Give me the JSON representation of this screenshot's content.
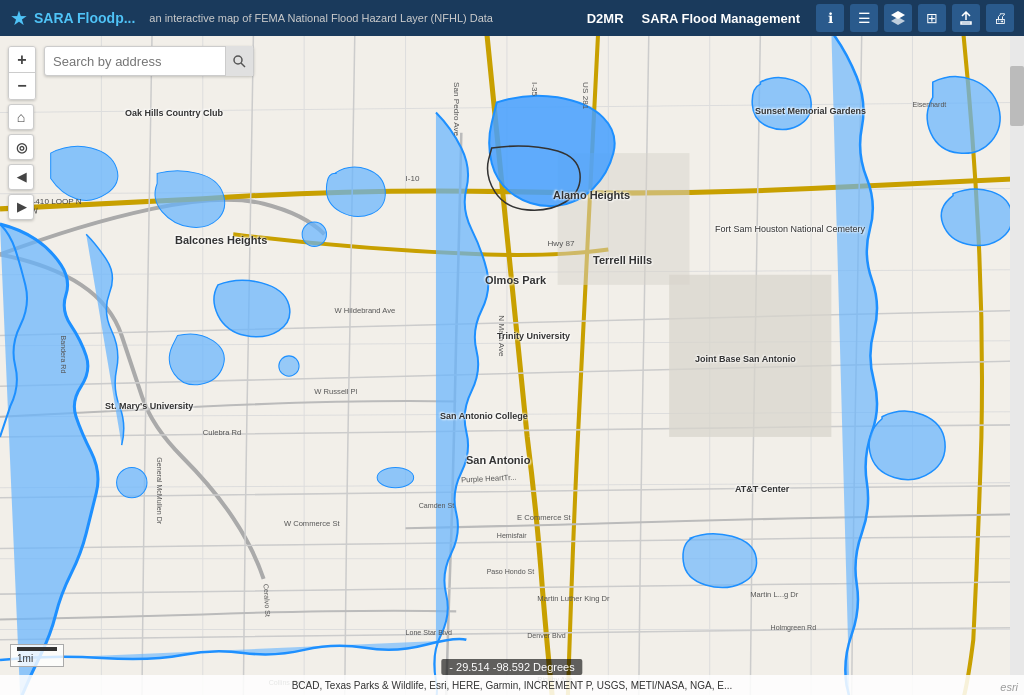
{
  "header": {
    "logo_star": "★",
    "app_title": "SARA Floodp...",
    "subtitle": "an interactive map of FEMA National Flood Hazard Layer (NFHL) Data",
    "nav_links": [
      "D2MR",
      "SARA Flood Management"
    ],
    "icons": [
      {
        "name": "info-icon",
        "symbol": "ℹ"
      },
      {
        "name": "list-icon",
        "symbol": "≡"
      },
      {
        "name": "layers-icon",
        "symbol": "⧉"
      },
      {
        "name": "grid-icon",
        "symbol": "⊞"
      },
      {
        "name": "export-icon",
        "symbol": "🎓"
      },
      {
        "name": "print-icon",
        "symbol": "🖨"
      }
    ]
  },
  "search": {
    "placeholder": "Search by address"
  },
  "toolbar": {
    "zoom_in": "+",
    "zoom_out": "−",
    "home": "⌂",
    "locate": "◎",
    "back": "◀",
    "forward": "▶"
  },
  "map_labels": [
    {
      "id": "balcones",
      "text": "Balcones Heights",
      "top": "200",
      "left": "195"
    },
    {
      "id": "alamo",
      "text": "Alamo Heights",
      "top": "155",
      "left": "555"
    },
    {
      "id": "olmos",
      "text": "Olmos Park",
      "top": "240",
      "left": "488"
    },
    {
      "id": "terrell",
      "text": "Terrell Hills",
      "top": "220",
      "left": "595"
    },
    {
      "id": "san_antonio",
      "text": "San Antonio",
      "top": "420",
      "left": "470"
    },
    {
      "id": "fort_sam",
      "text": "Fort Sam Houston National Cemetery",
      "top": "190",
      "left": "720"
    },
    {
      "id": "joint_base",
      "text": "Joint Base San Antonio",
      "top": "320",
      "left": "700"
    },
    {
      "id": "trinity",
      "text": "Trinity University",
      "top": "300",
      "left": "500"
    },
    {
      "id": "san_antonio_college",
      "text": "San Antonio College",
      "top": "380",
      "left": "445"
    },
    {
      "id": "st_marys",
      "text": "St. Mary's University",
      "top": "370",
      "left": "110"
    },
    {
      "id": "oak_hills",
      "text": "Oak Hills Country Club",
      "top": "75",
      "left": "130"
    },
    {
      "id": "sunset",
      "text": "Sunset Memorial Gardens",
      "top": "75",
      "left": "760"
    },
    {
      "id": "att",
      "text": "AT&T Center",
      "top": "450",
      "left": "740"
    }
  ],
  "scale": {
    "text": "1mi",
    "coordinates": "- 29.514 -98.592 Degrees"
  },
  "attribution": "BCAD, Texas Parks & Wildlife, Esri, HERE, Garmin, INCREMENT P, USGS, METI/NASA, NGA, E...",
  "esri_logo": "esri"
}
